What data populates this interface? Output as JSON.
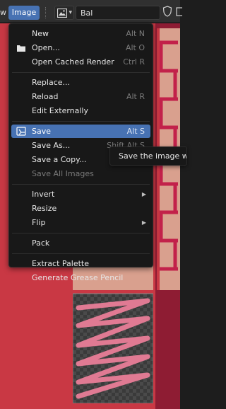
{
  "header": {
    "view_menu_fragment": "w",
    "image_menu_label": "Image",
    "image_name": "Bal",
    "image_type_icon": "image-icon",
    "shield_icon": "shield-icon",
    "copy_icon": "copy-icon"
  },
  "menu": {
    "items": [
      {
        "label": "New",
        "shortcut": "Alt N"
      },
      {
        "label": "Open...",
        "shortcut": "Alt O",
        "icon": "folder-icon"
      },
      {
        "label": "Open Cached Render",
        "shortcut": "Ctrl R"
      },
      {
        "label": "Replace...",
        "shortcut": ""
      },
      {
        "label": "Reload",
        "shortcut": "Alt R"
      },
      {
        "label": "Edit Externally",
        "shortcut": ""
      },
      {
        "label": "Save",
        "shortcut": "Alt S",
        "icon": "save-icon",
        "highlighted": true
      },
      {
        "label": "Save As...",
        "shortcut": "Shift Alt S"
      },
      {
        "label": "Save a Copy...",
        "shortcut": ""
      },
      {
        "label": "Save All Images",
        "shortcut": "",
        "disabled": true
      },
      {
        "label": "Invert",
        "shortcut": "",
        "submenu": true
      },
      {
        "label": "Resize",
        "shortcut": ""
      },
      {
        "label": "Flip",
        "shortcut": "",
        "submenu": true
      },
      {
        "label": "Pack",
        "shortcut": ""
      },
      {
        "label": "Extract Palette",
        "shortcut": ""
      },
      {
        "label": "Generate Grease Pencil",
        "shortcut": ""
      }
    ]
  },
  "tooltip": {
    "text": "Save the image with"
  },
  "colors": {
    "accent": "#4772b3",
    "menu_bg": "#181818",
    "canvas_red": "#c93844",
    "texture_pink": "#e07a93"
  }
}
